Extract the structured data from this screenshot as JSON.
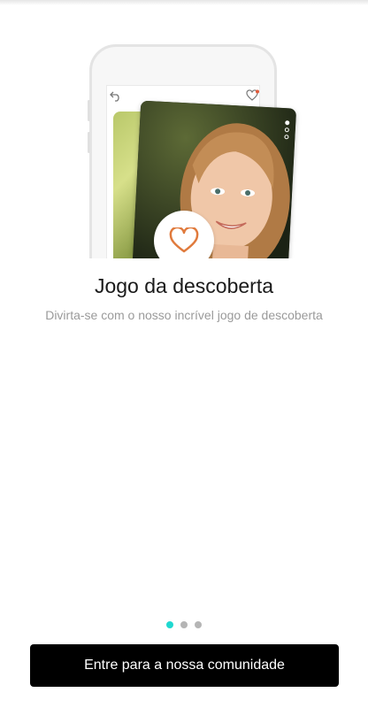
{
  "onboarding": {
    "title": "Jogo da descoberta",
    "subtitle": "Divirta-se com o nosso incrível jogo de descoberta",
    "pager": {
      "total": 3,
      "active_index": 0
    },
    "cta_label": "Entre para a nossa comunidade"
  },
  "illustration": {
    "icons": [
      "undo-icon",
      "heart-notification-icon",
      "heart-icon"
    ],
    "accent_color": "#1fd8d0",
    "heart_color": "#e07a3c"
  }
}
